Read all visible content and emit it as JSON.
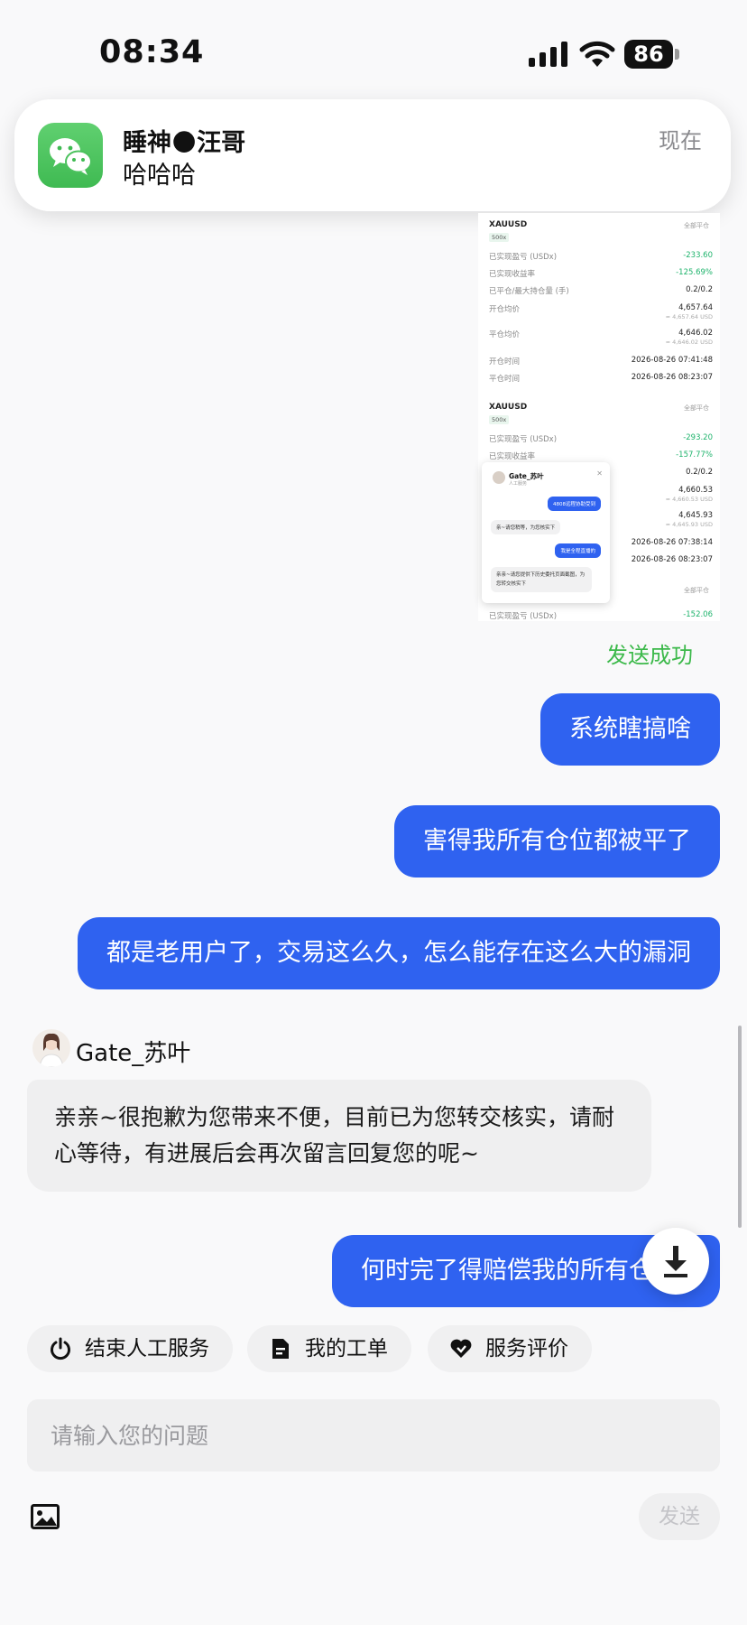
{
  "status_bar": {
    "time": "08:34",
    "battery": "86"
  },
  "notification": {
    "app_icon": "wechat-icon",
    "title": "睡神🌑汪哥",
    "message": "哈哈哈",
    "time": "现在"
  },
  "screenshot": {
    "sections": [
      {
        "symbol": "XAUUSD",
        "leverage": "500x",
        "close_all": "全部平仓",
        "rows": [
          {
            "k": "已实现盈亏 (USDx)",
            "v": "-233.60",
            "green": true
          },
          {
            "k": "已实现收益率",
            "v": "-125.69%",
            "green": true
          },
          {
            "k": "已平仓/最大持仓量 (手)",
            "v": "0.2/0.2"
          },
          {
            "k": "开仓均价",
            "v": "4,657.64",
            "sub": "≈ 4,657.64 USD"
          },
          {
            "k": "平仓均价",
            "v": "4,646.02",
            "sub": "≈ 4,646.02 USD"
          },
          {
            "k": "开仓时间",
            "v": "2026-08-26 07:41:48"
          },
          {
            "k": "平仓时间",
            "v": "2026-08-26 08:23:07"
          }
        ]
      },
      {
        "symbol": "XAUUSD",
        "leverage": "500x",
        "close_all": "全部平仓",
        "rows": [
          {
            "k": "已实现盈亏 (USDx)",
            "v": "-293.20",
            "green": true
          },
          {
            "k": "已实现收益率",
            "v": "-157.77%",
            "green": true
          },
          {
            "k": "",
            "v": "0.2/0.2"
          },
          {
            "k": "",
            "v": "4,660.53",
            "sub": "≈ 4,660.53 USD"
          },
          {
            "k": "",
            "v": "4,645.93",
            "sub": "≈ 4,645.93 USD"
          },
          {
            "k": "",
            "v": "2026-08-26 07:38:14"
          },
          {
            "k": "",
            "v": "2026-08-26 08:23:07"
          }
        ]
      },
      {
        "close_all": "全部平仓",
        "rows": [
          {
            "k": "已实现盈亏 (USDx)",
            "v": "-152.06",
            "green": true
          }
        ]
      }
    ],
    "mini_chat": {
      "agent": "Gate_苏叶",
      "agent_sub": "人工服务",
      "messages": [
        {
          "from": "me",
          "text": "4808远程协助受到"
        },
        {
          "from": "them",
          "text": "亲~请您稍等，为您核实下"
        },
        {
          "from": "me",
          "text": "我是全程直播的"
        },
        {
          "from": "them",
          "text": "亲亲~请您提供下历史委托页面截图，为您转交核实下"
        }
      ]
    }
  },
  "send_status": "发送成功",
  "messages": [
    {
      "text": "系统瞎搞啥"
    },
    {
      "text": "害得我所有仓位都被平了"
    },
    {
      "text": "都是老用户了，交易这么久，怎么能存在这么大的漏洞"
    }
  ],
  "agent": {
    "name": "Gate_苏叶",
    "reply": "亲亲~很抱歉为您带来不便，目前已为您转交核实，请耐心等待，有进展后会再次留言回复您的呢~"
  },
  "last_message": "何时完了得赔偿我的所有仓位",
  "actions": [
    {
      "label": "结束人工服务",
      "icon": "power-icon"
    },
    {
      "label": "我的工单",
      "icon": "document-icon"
    },
    {
      "label": "服务评价",
      "icon": "heart-icon"
    }
  ],
  "composer": {
    "placeholder": "请输入您的问题",
    "send": "发送"
  },
  "colors": {
    "accent": "#2f62f0",
    "success": "#3cb94a",
    "loss": "#1db36b"
  }
}
